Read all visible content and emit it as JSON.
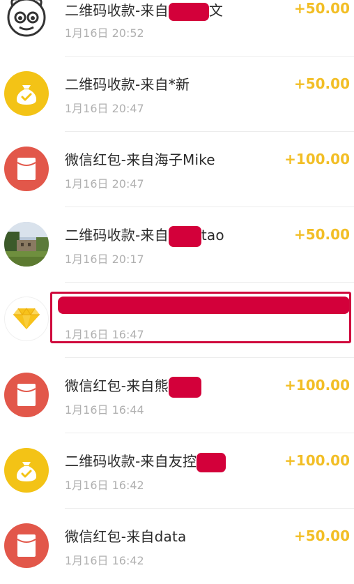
{
  "colors": {
    "amount": "#f2be25",
    "redaction": "#d3003a",
    "highlight_border": "#cf0a3d",
    "qr_avatar": "#f3c316",
    "redpacket_avatar": "#e2574a"
  },
  "transactions": [
    {
      "title_prefix": "二维码收款-来自",
      "title_suffix": "文",
      "time": "1月16日 20:52",
      "amount": "+50.00",
      "avatar": "cartoon-face-icon"
    },
    {
      "title_prefix": "二维码收款-来自*新",
      "title_suffix": "",
      "time": "1月16日 20:47",
      "amount": "+50.00",
      "avatar": "money-bag-icon"
    },
    {
      "title_prefix": "微信红包-来自海子Mike",
      "title_suffix": "",
      "time": "1月16日 20:47",
      "amount": "+100.00",
      "avatar": "red-packet-icon"
    },
    {
      "title_prefix": "二维码收款-来自",
      "title_suffix": "tao",
      "time": "1月16日 20:17",
      "amount": "+50.00",
      "avatar": "landscape-photo-avatar"
    },
    {
      "title_prefix": "",
      "title_suffix": "",
      "time": "1月16日 16:47",
      "amount": "",
      "avatar": "diamond-icon"
    },
    {
      "title_prefix": "微信红包-来自熊",
      "title_suffix": "",
      "time": "1月16日 16:44",
      "amount": "+100.00",
      "avatar": "red-packet-icon"
    },
    {
      "title_prefix": "二维码收款-来自友控",
      "title_suffix": "",
      "time": "1月16日 16:42",
      "amount": "+100.00",
      "avatar": "money-bag-icon"
    },
    {
      "title_prefix": "微信红包-来自data",
      "title_suffix": "",
      "time": "1月16日 16:42",
      "amount": "+50.00",
      "avatar": "red-packet-icon"
    }
  ]
}
